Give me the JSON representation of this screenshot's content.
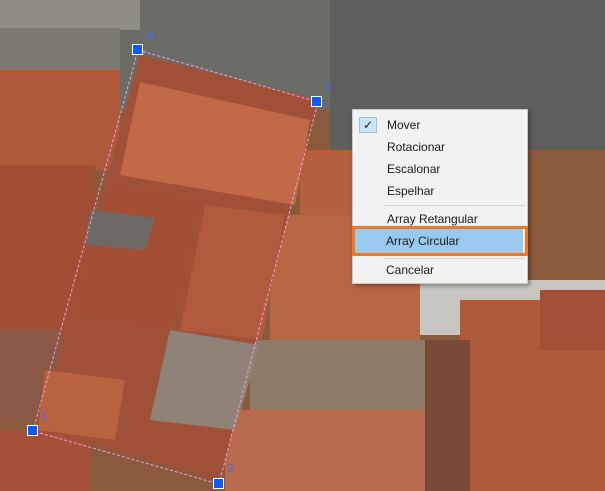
{
  "vertices": {
    "v0": "0",
    "v1": "1",
    "v2": "2",
    "v3": "3"
  },
  "context_menu": {
    "items": [
      {
        "label": "Mover",
        "checked": true
      },
      {
        "label": "Rotacionar",
        "checked": false
      },
      {
        "label": "Escalonar",
        "checked": false
      },
      {
        "label": "Espelhar",
        "checked": false
      },
      {
        "label": "Array Retangular",
        "checked": false
      },
      {
        "label": "Array Circular",
        "checked": false,
        "highlighted": true
      },
      {
        "label": "Cancelar",
        "checked": false
      }
    ],
    "check_glyph": "✓"
  },
  "colors": {
    "selection_handle": "#0a5cff",
    "highlight": "#99c9ef",
    "annotation_outline": "#f07822",
    "selection_outline": "#ff9ad8"
  },
  "icons": {
    "check": "checkmark-icon"
  }
}
